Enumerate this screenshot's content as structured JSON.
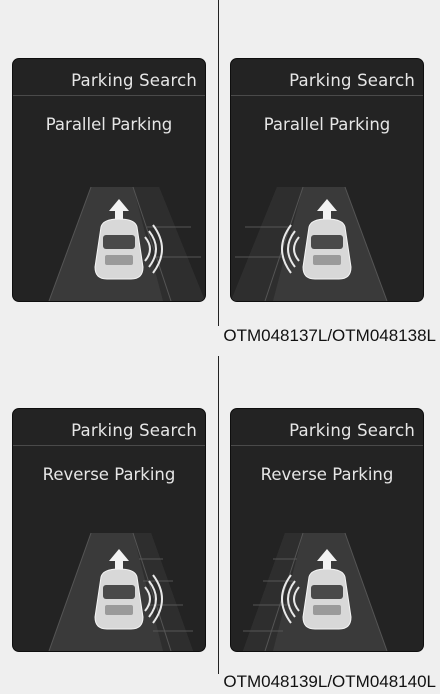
{
  "panels": [
    {
      "title": "Parking Search",
      "mode": "Parallel Parking",
      "sensor_side": "right"
    },
    {
      "title": "Parking Search",
      "mode": "Parallel Parking",
      "sensor_side": "left"
    },
    {
      "title": "Parking Search",
      "mode": "Reverse Parking",
      "sensor_side": "right"
    },
    {
      "title": "Parking Search",
      "mode": "Reverse Parking",
      "sensor_side": "left"
    }
  ],
  "captions": {
    "top": "OTM048137L/OTM048138L",
    "bottom": "OTM048139L/OTM048140L"
  },
  "colors": {
    "background": "#efefef",
    "panel": "#232323",
    "text": "#e6e6e6"
  }
}
